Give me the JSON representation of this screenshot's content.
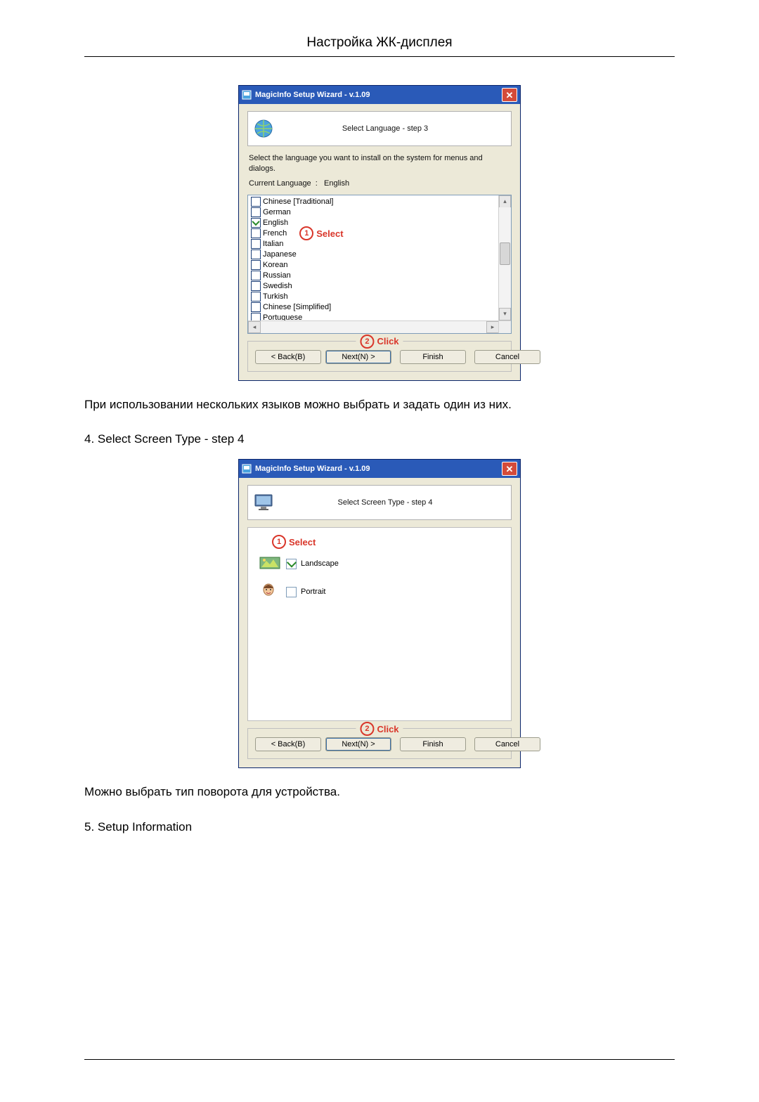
{
  "page_title": "Настройка ЖК-дисплея",
  "wizard_title": "MagicInfo Setup Wizard - v.1.09",
  "step3": {
    "title": "Select Language - step 3",
    "instruction": "Select the language you want to install on the system for menus and dialogs.",
    "current_label": "Current Language",
    "current_value": "English",
    "languages": [
      {
        "label": "Chinese [Traditional]",
        "checked": false
      },
      {
        "label": "German",
        "checked": false
      },
      {
        "label": "English",
        "checked": true
      },
      {
        "label": "French",
        "checked": false
      },
      {
        "label": "Italian",
        "checked": false
      },
      {
        "label": "Japanese",
        "checked": false
      },
      {
        "label": "Korean",
        "checked": false
      },
      {
        "label": "Russian",
        "checked": false
      },
      {
        "label": "Swedish",
        "checked": false
      },
      {
        "label": "Turkish",
        "checked": false
      },
      {
        "label": "Chinese [Simplified]",
        "checked": false
      },
      {
        "label": "Portuguese",
        "checked": false
      }
    ],
    "callout_select": "Select",
    "callout_click": "Click"
  },
  "body_after_step3": "При использовании нескольких языков можно выбрать и задать один из них.",
  "heading_step4": "4. Select Screen Type - step 4",
  "step4": {
    "title": "Select Screen Type - step 4",
    "callout_select": "Select",
    "callout_click": "Click",
    "options": {
      "landscape": {
        "label": "Landscape",
        "checked": true
      },
      "portrait": {
        "label": "Portrait",
        "checked": false
      }
    }
  },
  "body_after_step4": "Можно выбрать тип поворота для устройства.",
  "heading_step5": "5. Setup Information",
  "buttons": {
    "back": "< Back(B)",
    "next": "Next(N) >",
    "finish": "Finish",
    "cancel": "Cancel"
  }
}
